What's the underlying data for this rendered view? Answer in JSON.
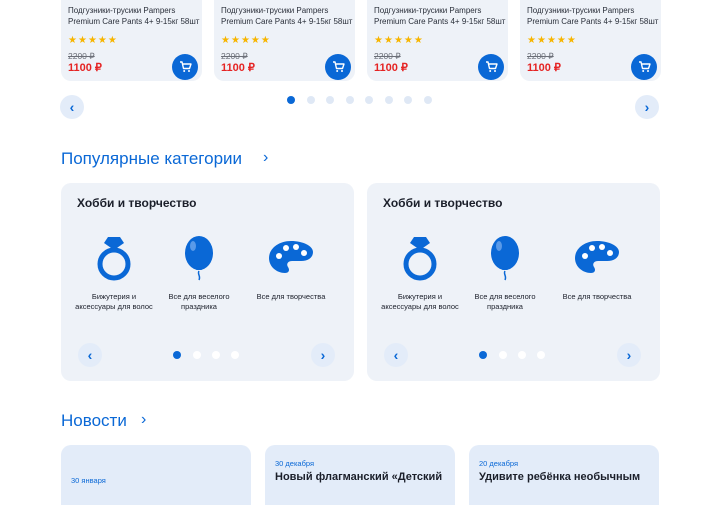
{
  "products": [
    {
      "name": "Подгузники-трусики Pampers Premium Care Pants 4+ 9-15кг 58шт",
      "old_price": "2200 ₽",
      "price": "1100 ₽",
      "rating": 5
    },
    {
      "name": "Подгузники-трусики Pampers Premium Care Pants 4+ 9-15кг 58шт",
      "old_price": "2200 ₽",
      "price": "1100 ₽",
      "rating": 5
    },
    {
      "name": "Подгузники-трусики Pampers Premium Care Pants 4+ 9-15кг 58шт",
      "old_price": "2200 ₽",
      "price": "1100 ₽",
      "rating": 5
    },
    {
      "name": "Подгузники-трусики Pampers Premium Care Pants 4+ 9-15кг 58шт",
      "old_price": "2200 ₽",
      "price": "1100 ₽",
      "rating": 5
    }
  ],
  "products_carousel": {
    "prev": "‹",
    "next": "›",
    "pages": 8,
    "active": 0
  },
  "categories_section": {
    "title": "Популярные категории",
    "chevron": "›"
  },
  "category_panels": [
    {
      "title": "Хобби и творчество",
      "items": [
        {
          "label": "Бижутерия и аксессуары для волос",
          "icon": "ring-icon"
        },
        {
          "label": "Все для веселого праздника",
          "icon": "balloon-icon"
        },
        {
          "label": "Все для творчества",
          "icon": "palette-icon"
        }
      ],
      "prev": "‹",
      "next": "›",
      "pages": 4,
      "active": 0
    },
    {
      "title": "Хобби и творчество",
      "items": [
        {
          "label": "Бижутерия и аксессуары для волос",
          "icon": "ring-icon"
        },
        {
          "label": "Все для веселого праздника",
          "icon": "balloon-icon"
        },
        {
          "label": "Все для творчества",
          "icon": "palette-icon"
        }
      ],
      "prev": "‹",
      "next": "›",
      "pages": 4,
      "active": 0
    }
  ],
  "news_section": {
    "title": "Новости",
    "chevron": "›"
  },
  "news": [
    {
      "date": "30 января",
      "headline": ""
    },
    {
      "date": "30 декабря",
      "headline": "Новый флагманский «Детский"
    },
    {
      "date": "20 декабря",
      "headline": "Удивите ребёнка необычным"
    }
  ],
  "colors": {
    "accent": "#0a68d6",
    "price": "#e52424",
    "star": "#f7b500",
    "card_bg": "#eef2f8"
  }
}
